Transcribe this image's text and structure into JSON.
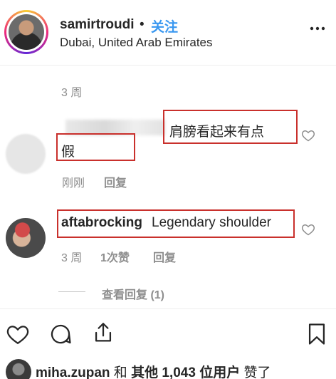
{
  "header": {
    "username": "samirtroudi",
    "dot": "•",
    "follow_label": "关注",
    "location": "Dubai, United Arab Emirates",
    "more_icon": "more-horizontal-icon"
  },
  "post_time": "3 周",
  "comments": [
    {
      "username": "",
      "text_line1": "肩膀看起来有点",
      "text_line2": "假",
      "time": "刚刚",
      "reply_label": "回复"
    },
    {
      "username": "aftabrocking",
      "text": "Legendary shoulder",
      "time": "3 周",
      "likes": "1次赞",
      "reply_label": "回复",
      "view_replies": "查看回复 (1)"
    }
  ],
  "actions": {
    "like_icon": "heart-icon",
    "comment_icon": "comment-icon",
    "share_icon": "share-icon",
    "save_icon": "bookmark-icon"
  },
  "likes": {
    "user": "miha.zupan",
    "and": "和",
    "others": "其他 1,043 位用户",
    "liked": "赞了"
  },
  "colors": {
    "link_blue": "#3897f0",
    "annotation_red": "#c9302c",
    "secondary_text": "#8e8e8e"
  }
}
